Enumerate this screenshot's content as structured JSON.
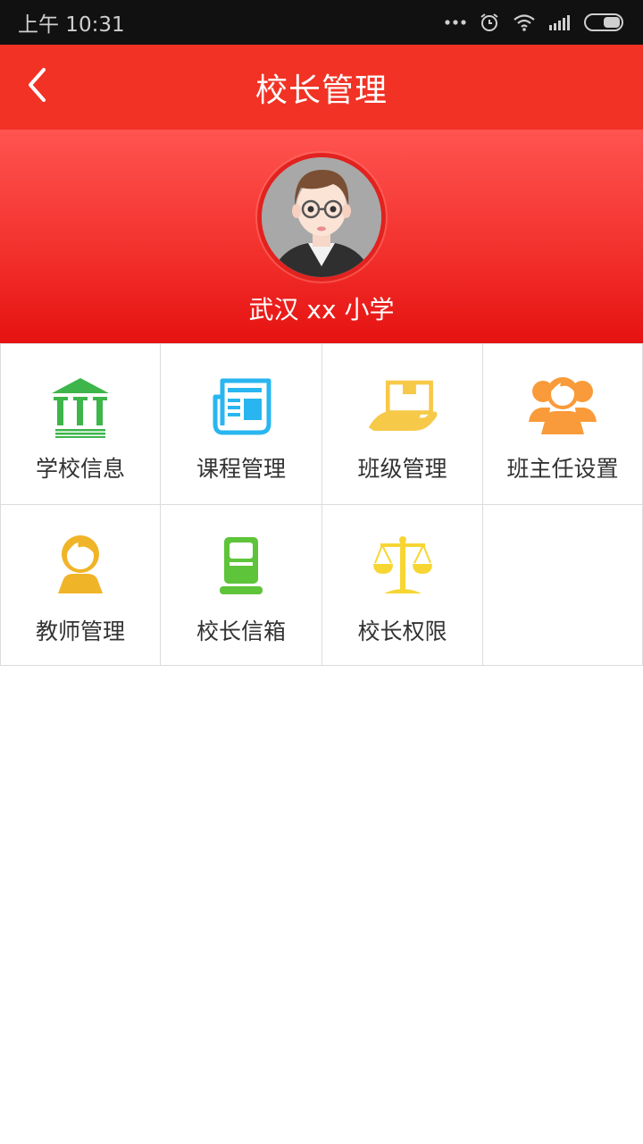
{
  "status_bar": {
    "time": "上午 10:31",
    "icons": [
      "more-dots-icon",
      "alarm-icon",
      "wifi-icon",
      "signal-icon",
      "battery-icon"
    ]
  },
  "nav": {
    "title": "校长管理",
    "back_icon": "chevron-left-icon"
  },
  "profile": {
    "school_name": "武汉 xx 小学"
  },
  "grid": {
    "items": [
      {
        "label": "学校信息",
        "icon": "school-building-icon",
        "color": "#3db54a"
      },
      {
        "label": "课程管理",
        "icon": "newspaper-icon",
        "color": "#29b6f0"
      },
      {
        "label": "班级管理",
        "icon": "hand-box-icon",
        "color": "#f7c948"
      },
      {
        "label": "班主任设置",
        "icon": "group-person-icon",
        "color": "#f99b3a"
      },
      {
        "label": "教师管理",
        "icon": "teacher-person-icon",
        "color": "#f0b429"
      },
      {
        "label": "校长信箱",
        "icon": "mailbox-icon",
        "color": "#5ec43a"
      },
      {
        "label": "校长权限",
        "icon": "balance-scale-icon",
        "color": "#f7d634"
      }
    ]
  },
  "colors": {
    "status_bar_bg": "#111111",
    "nav_bg": "#f13224",
    "banner_top": "#ff5450",
    "banner_bottom": "#e51211"
  }
}
